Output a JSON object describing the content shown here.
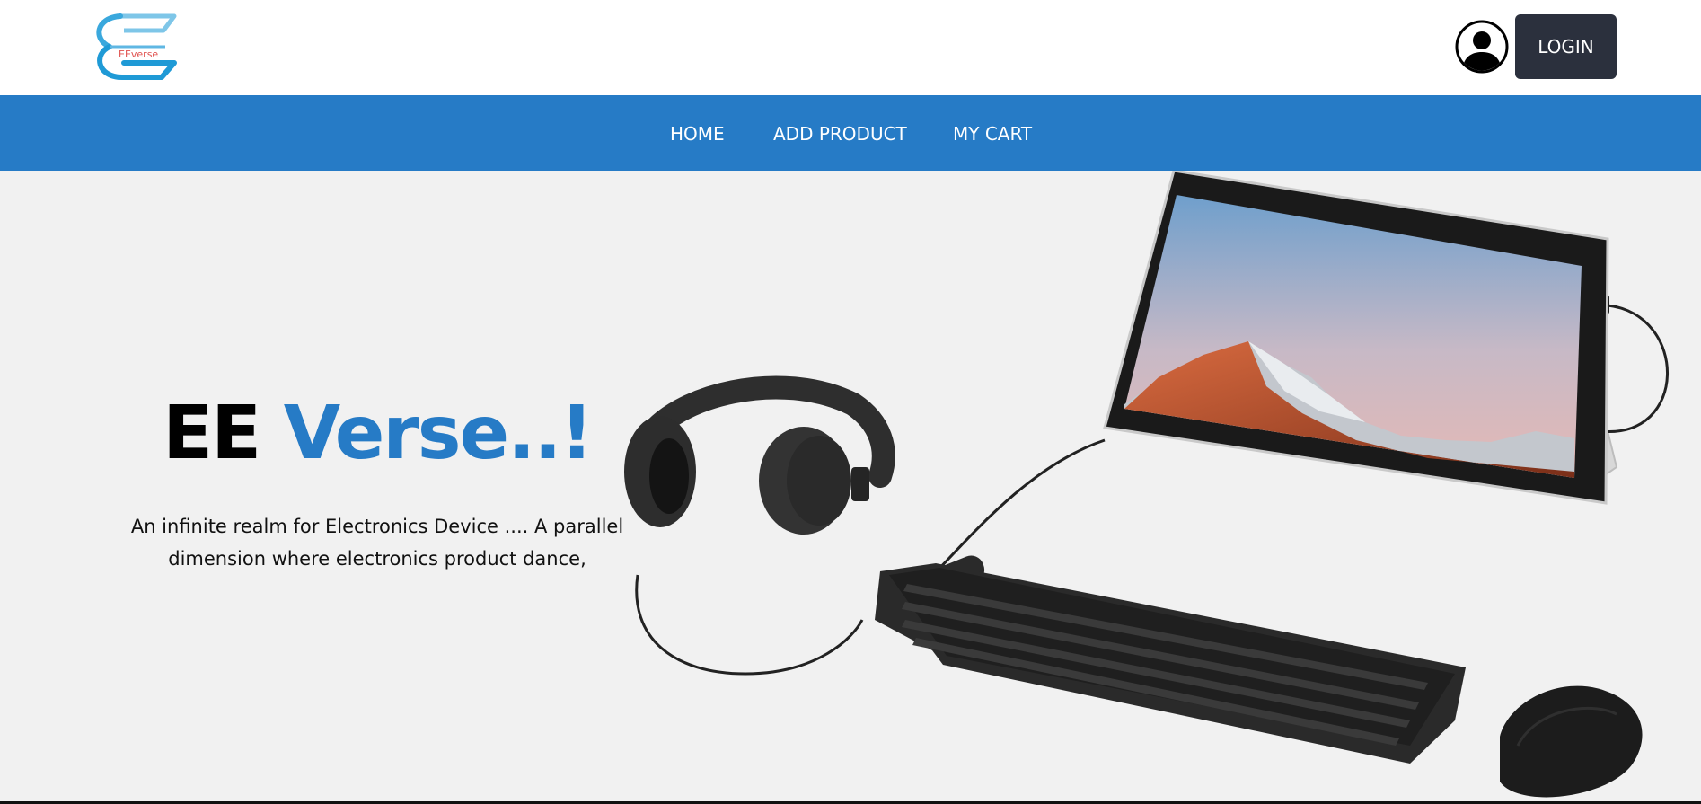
{
  "brand": {
    "logo_text": "EEverse"
  },
  "header": {
    "login_label": "LOGIN",
    "avatar_icon": "user-avatar-icon"
  },
  "nav": {
    "items": [
      {
        "label": "HOME"
      },
      {
        "label": "ADD PRODUCT"
      },
      {
        "label": "MY CART"
      }
    ]
  },
  "hero": {
    "title_part1": "EE",
    "title_part2": "Verse..!",
    "desc_line1": "An infinite realm for Electronics Device .... A parallel",
    "desc_line2": "dimension where electronics product dance,"
  },
  "colors": {
    "accent": "#267bc6",
    "login_bg": "#2b303d",
    "hero_bg": "#f1f1f1"
  }
}
